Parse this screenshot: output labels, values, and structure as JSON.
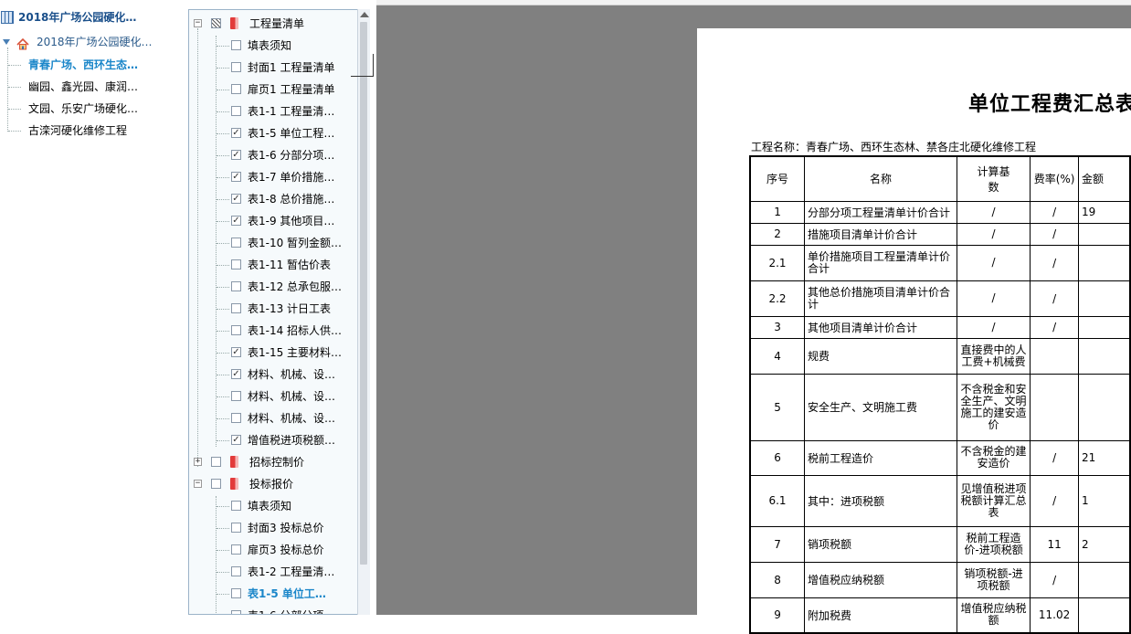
{
  "project_tree": {
    "root": {
      "label": "2018年广场公园硬化…",
      "icon": "building-icon"
    },
    "child": {
      "label": "2018年广场公园硬化…",
      "icon": "home-icon"
    },
    "items": [
      {
        "label": "青春广场、西环生态…",
        "active": true
      },
      {
        "label": "幽园、鑫光园、康润…",
        "active": false
      },
      {
        "label": "文园、乐安广场硬化…",
        "active": false
      },
      {
        "label": "古滦河硬化维修工程",
        "active": false
      }
    ]
  },
  "report_tree": {
    "groups": [
      {
        "label": "工程量清单",
        "expanded": true,
        "check": "partial",
        "items": [
          {
            "label": "填表须知",
            "checked": false
          },
          {
            "label": "封面1 工程量清单",
            "checked": false
          },
          {
            "label": "扉页1 工程量清单",
            "checked": false
          },
          {
            "label": "表1-1 工程量清…",
            "checked": false
          },
          {
            "label": "表1-5 单位工程…",
            "checked": true
          },
          {
            "label": "表1-6 分部分项…",
            "checked": true
          },
          {
            "label": "表1-7 单价措施…",
            "checked": true
          },
          {
            "label": "表1-8 总价措施…",
            "checked": true
          },
          {
            "label": "表1-9 其他项目…",
            "checked": true
          },
          {
            "label": "表1-10 暂列金额…",
            "checked": false
          },
          {
            "label": "表1-11 暂估价表",
            "checked": false
          },
          {
            "label": "表1-12 总承包服…",
            "checked": false
          },
          {
            "label": "表1-13 计日工表",
            "checked": false
          },
          {
            "label": "表1-14 招标人供…",
            "checked": false
          },
          {
            "label": "表1-15 主要材料…",
            "checked": true
          },
          {
            "label": "材料、机械、设…",
            "checked": true
          },
          {
            "label": "材料、机械、设…",
            "checked": false
          },
          {
            "label": "材料、机械、设…",
            "checked": false
          },
          {
            "label": "增值税进项税额…",
            "checked": true
          }
        ]
      },
      {
        "label": "招标控制价",
        "expanded": false,
        "check": "none",
        "items": []
      },
      {
        "label": "投标报价",
        "expanded": true,
        "check": "none",
        "items": [
          {
            "label": "填表须知",
            "checked": false
          },
          {
            "label": "封面3 投标总价",
            "checked": false
          },
          {
            "label": "扉页3 投标总价",
            "checked": false
          },
          {
            "label": "表1-2 工程量清…",
            "checked": false
          },
          {
            "label": "表1-5 单位工…",
            "checked": false,
            "active": true
          },
          {
            "label": "表1-6 分部分项…",
            "checked": false
          }
        ]
      }
    ]
  },
  "document": {
    "title": "单位工程费汇总表",
    "project_name": "工程名称：青春广场、西环生态林、禁各庄北硬化维修工程",
    "headers": [
      "序号",
      "名称",
      "计算基数",
      "费率(%)",
      "金额"
    ],
    "rows": [
      {
        "no": "1",
        "name": "分部分项工程量清单计价合计",
        "basis": "/",
        "rate": "/",
        "amount": "19"
      },
      {
        "no": "2",
        "name": "措施项目清单计价合计",
        "basis": "/",
        "rate": "/",
        "amount": ""
      },
      {
        "no": "2.1",
        "name": "单价措施项目工程量清单计价合计",
        "basis": "/",
        "rate": "/",
        "amount": ""
      },
      {
        "no": "2.2",
        "name": "其他总价措施项目清单计价合计",
        "basis": "/",
        "rate": "/",
        "amount": ""
      },
      {
        "no": "3",
        "name": "其他项目清单计价合计",
        "basis": "/",
        "rate": "/",
        "amount": ""
      },
      {
        "no": "4",
        "name": "规费",
        "basis": "直接费中的人工费+机械费",
        "rate": "",
        "amount": ""
      },
      {
        "no": "5",
        "name": "安全生产、文明施工费",
        "basis": "不含税金和安全生产、文明施工的建安造价",
        "rate": "",
        "amount": ""
      },
      {
        "no": "6",
        "name": "税前工程造价",
        "basis": "不含税金的建安造价",
        "rate": "/",
        "amount": "21"
      },
      {
        "no": "6.1",
        "name": "其中：进项税额",
        "basis": "见增值税进项税额计算汇总表",
        "rate": "/",
        "amount": "1"
      },
      {
        "no": "7",
        "name": "销项税额",
        "basis": "税前工程造价-进项税额",
        "rate": "11",
        "amount": "2"
      },
      {
        "no": "8",
        "name": "增值税应纳税额",
        "basis": "销项税额-进项税额",
        "rate": "/",
        "amount": ""
      },
      {
        "no": "9",
        "name": "附加税费",
        "basis": "增值税应纳税额",
        "rate": "11.02",
        "amount": ""
      }
    ]
  }
}
